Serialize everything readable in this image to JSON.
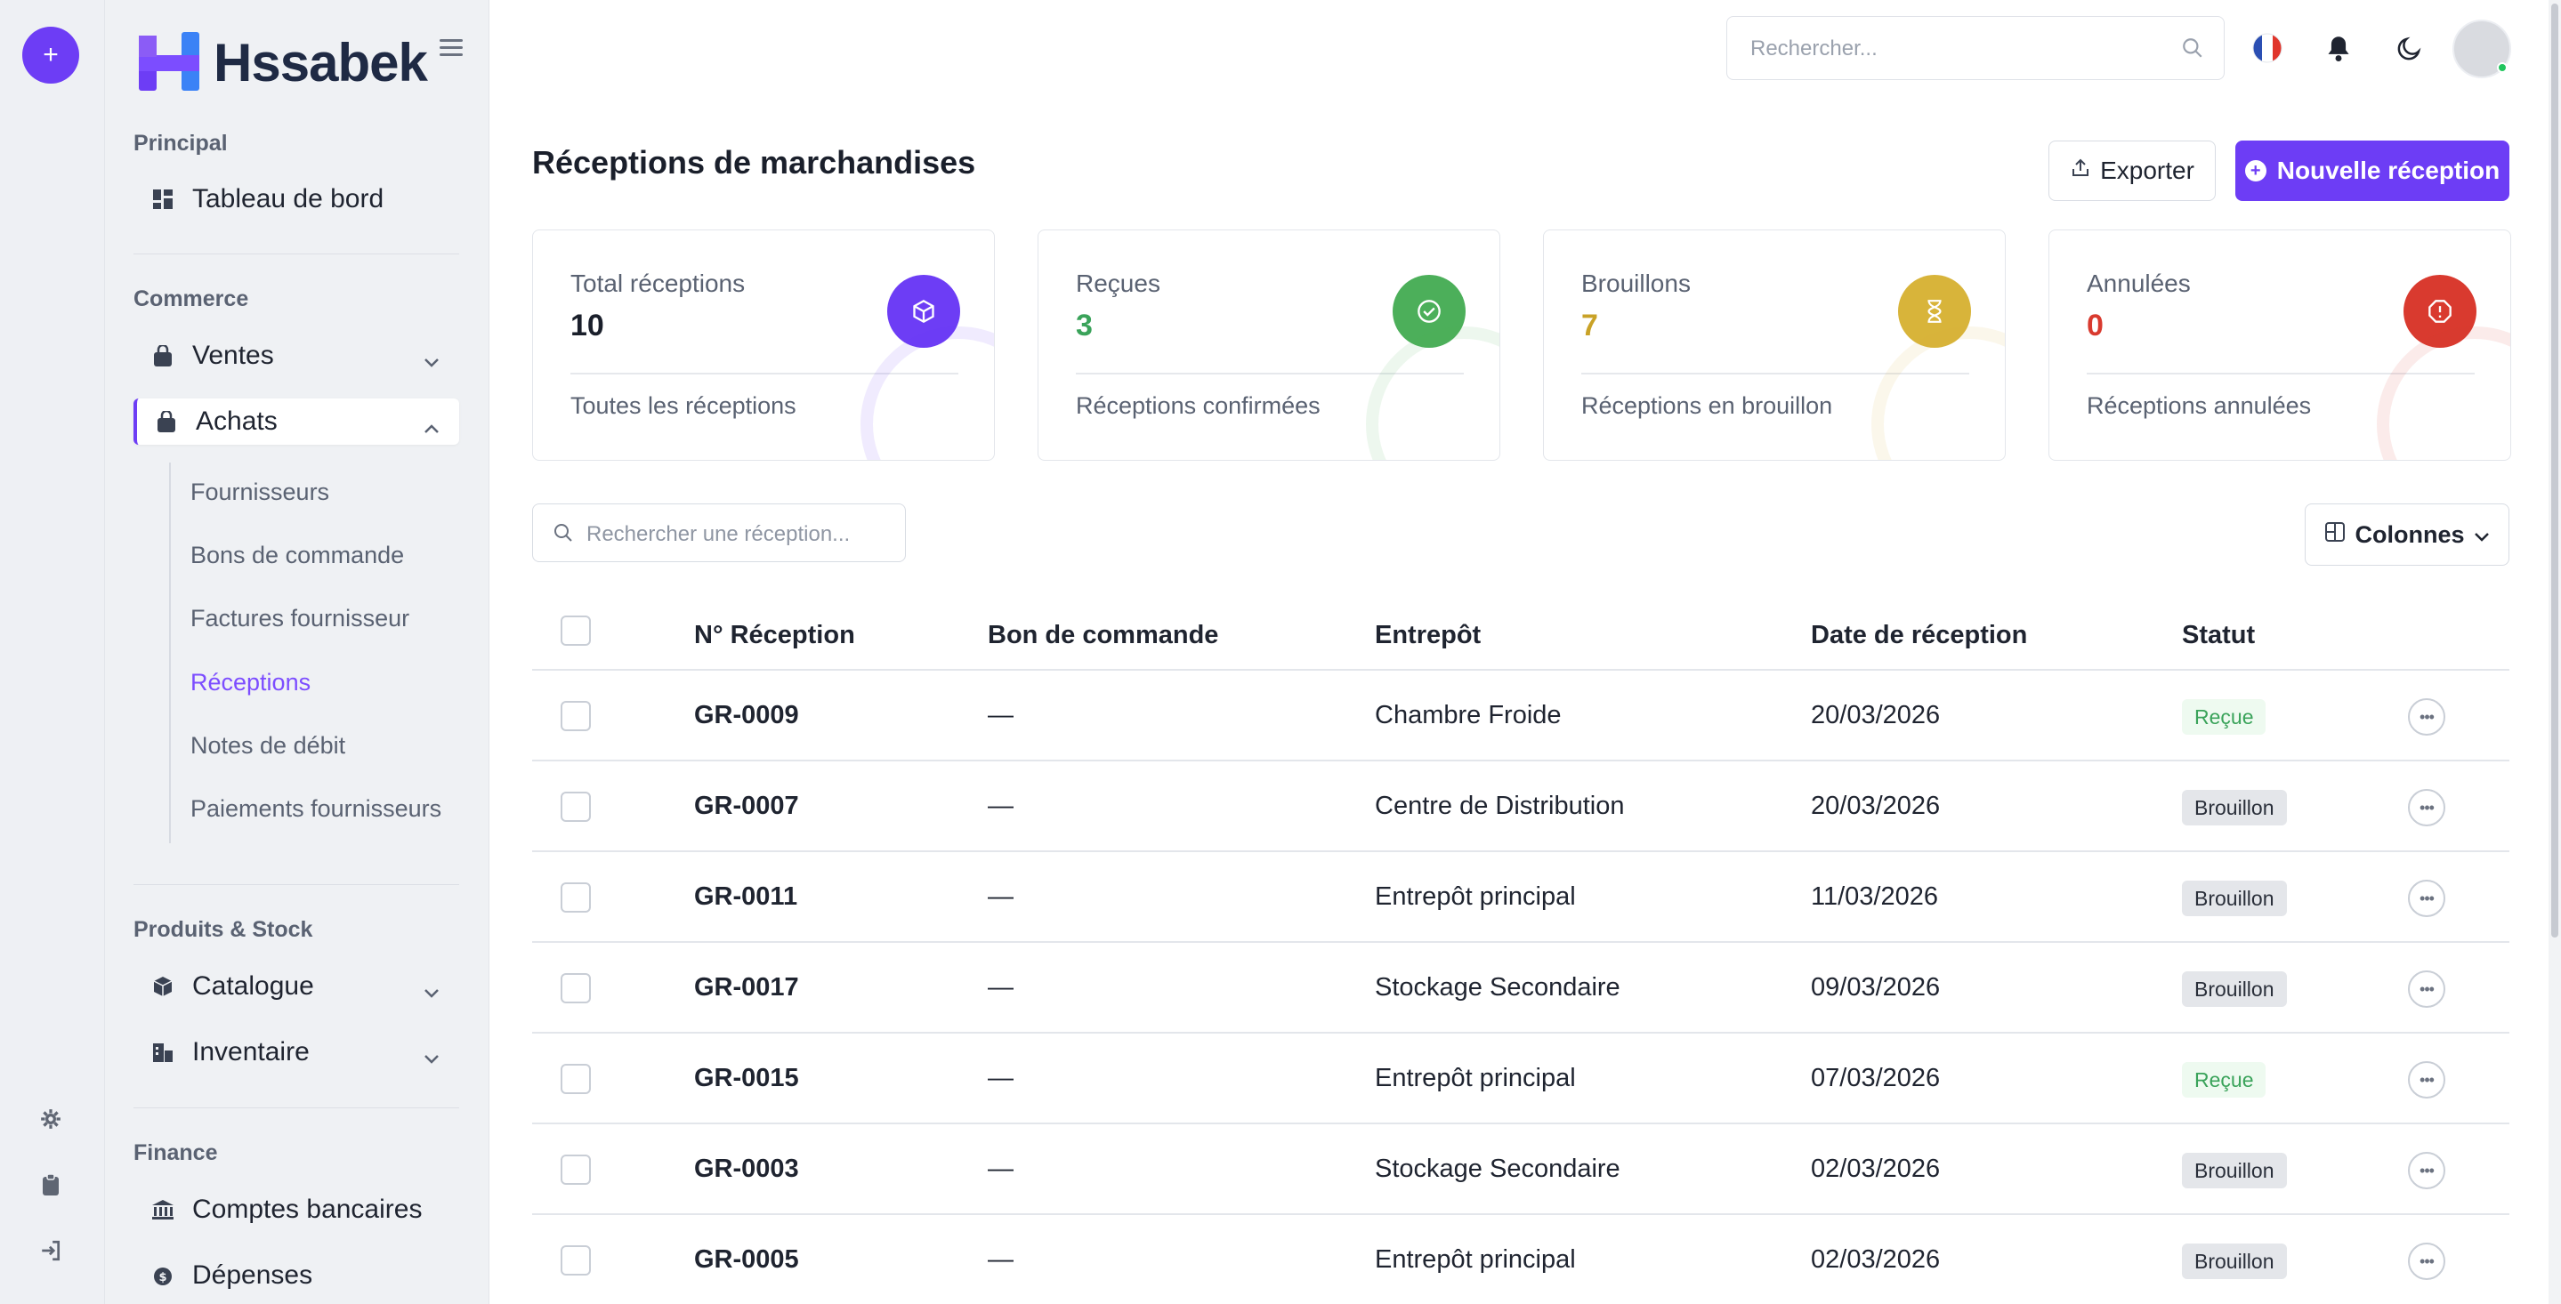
{
  "rail": {
    "plus": "+",
    "icons": [
      "gear-icon",
      "clipboard-icon",
      "logout-icon"
    ]
  },
  "brand": {
    "name": "Hssabek"
  },
  "sidebar": {
    "sections": {
      "principal": "Principal",
      "commerce": "Commerce",
      "produits": "Produits & Stock",
      "finance": "Finance"
    },
    "items": {
      "tableau": "Tableau de bord",
      "ventes": "Ventes",
      "achats": "Achats",
      "catalogue": "Catalogue",
      "inventaire": "Inventaire",
      "comptes": "Comptes bancaires",
      "depenses": "Dépenses"
    },
    "achats_sub": [
      "Fournisseurs",
      "Bons de commande",
      "Factures fournisseur",
      "Réceptions",
      "Notes de débit",
      "Paiements fournisseurs"
    ],
    "active_sub": "Réceptions"
  },
  "header": {
    "search_placeholder": "Rechercher..."
  },
  "page": {
    "title": "Réceptions de marchandises",
    "export_label": "Exporter",
    "new_label": "Nouvelle réception"
  },
  "stats": [
    {
      "label": "Total réceptions",
      "value": "10",
      "desc": "Toutes les réceptions",
      "color": "#6d3df5",
      "icon": "box-icon",
      "value_color": "#1a1f2b"
    },
    {
      "label": "Reçues",
      "value": "3",
      "desc": "Réceptions confirmées",
      "color": "#4caf5a",
      "icon": "check-circle-icon",
      "value_color": "#3aa35a"
    },
    {
      "label": "Brouillons",
      "value": "7",
      "desc": "Réceptions en brouillon",
      "color": "#d8b43a",
      "icon": "hourglass-icon",
      "value_color": "#c9a227"
    },
    {
      "label": "Annulées",
      "value": "0",
      "desc": "Réceptions annulées",
      "color": "#d93a2f",
      "icon": "alert-icon",
      "value_color": "#d93a2f"
    }
  ],
  "table": {
    "search_placeholder": "Rechercher une réception...",
    "columns_label": "Colonnes",
    "headers": [
      "N° Réception",
      "Bon de commande",
      "Entrepôt",
      "Date de réception",
      "Statut"
    ],
    "rows": [
      {
        "id": "GR-0009",
        "bon": "—",
        "entrepot": "Chambre Froide",
        "date": "20/03/2026",
        "statut": "Reçue"
      },
      {
        "id": "GR-0007",
        "bon": "—",
        "entrepot": "Centre de Distribution",
        "date": "20/03/2026",
        "statut": "Brouillon"
      },
      {
        "id": "GR-0011",
        "bon": "—",
        "entrepot": "Entrepôt principal",
        "date": "11/03/2026",
        "statut": "Brouillon"
      },
      {
        "id": "GR-0017",
        "bon": "—",
        "entrepot": "Stockage Secondaire",
        "date": "09/03/2026",
        "statut": "Brouillon"
      },
      {
        "id": "GR-0015",
        "bon": "—",
        "entrepot": "Entrepôt principal",
        "date": "07/03/2026",
        "statut": "Reçue"
      },
      {
        "id": "GR-0003",
        "bon": "—",
        "entrepot": "Stockage Secondaire",
        "date": "02/03/2026",
        "statut": "Brouillon"
      },
      {
        "id": "GR-0005",
        "bon": "—",
        "entrepot": "Entrepôt principal",
        "date": "02/03/2026",
        "statut": "Brouillon"
      }
    ]
  }
}
